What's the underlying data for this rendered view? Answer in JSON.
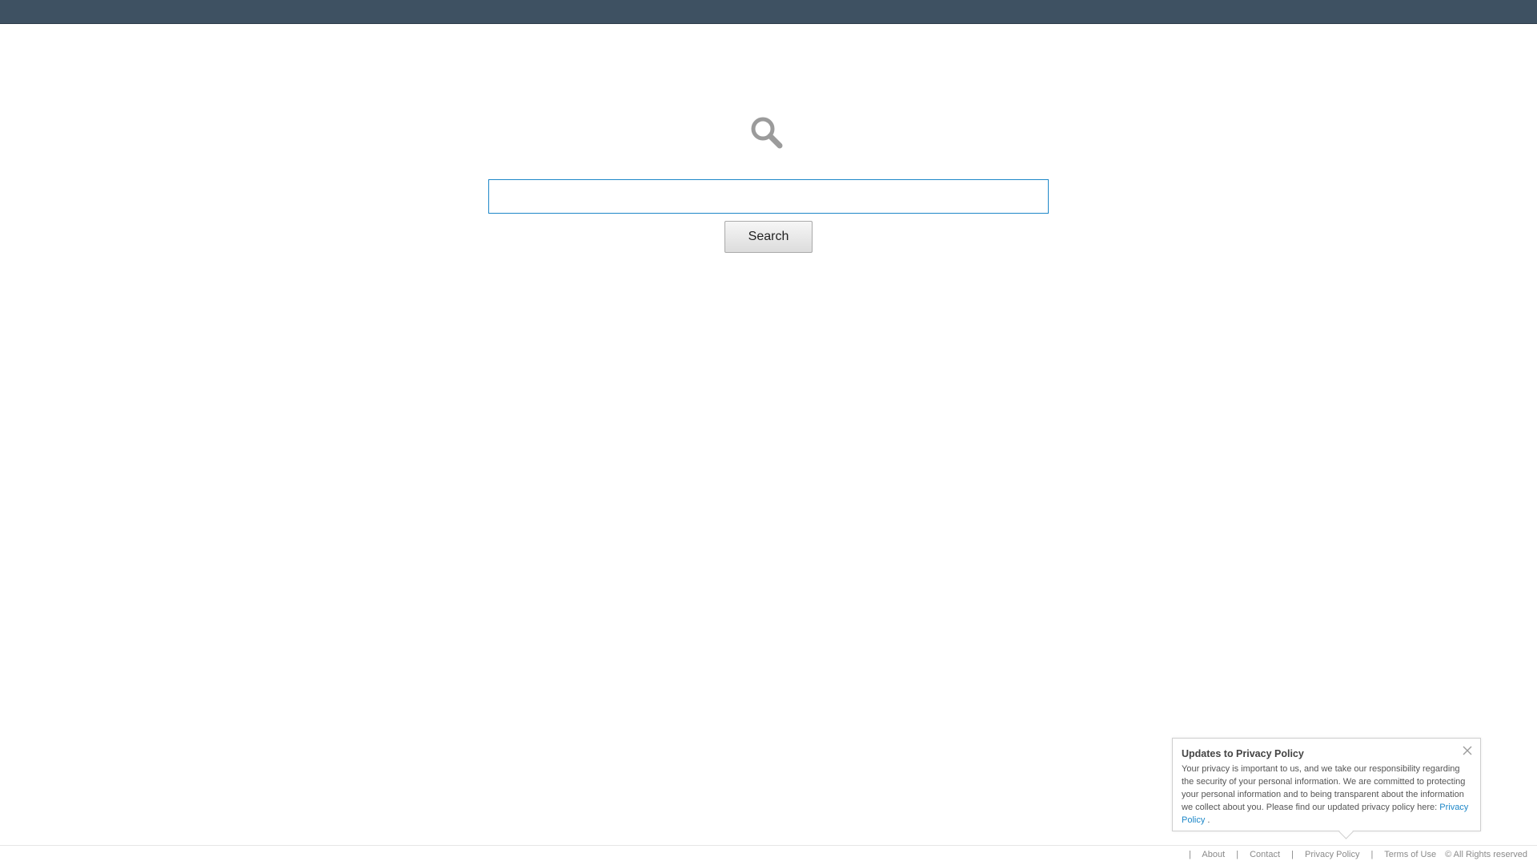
{
  "header": {
    "bar_color": "#3e5162"
  },
  "search": {
    "logo_icon": "magnifier-icon",
    "input_value": "",
    "button_label": "Search",
    "accent_color": "#1d87c8"
  },
  "privacy_popup": {
    "title": "Updates to Privacy Policy",
    "body": "Your privacy is important to us, and we take our responsibility regarding the security of your personal information. We are committed to protecting your personal information and to being transparent about the information we collect about you. Please find our updated privacy policy here: ",
    "link_label": "Privacy Policy",
    "trailing": ".",
    "close_icon": "close-icon"
  },
  "footer": {
    "separator": "|",
    "links": [
      "About",
      "Contact",
      "Privacy Policy",
      "Terms of Use"
    ],
    "copyright": "© All Rights reserved"
  }
}
